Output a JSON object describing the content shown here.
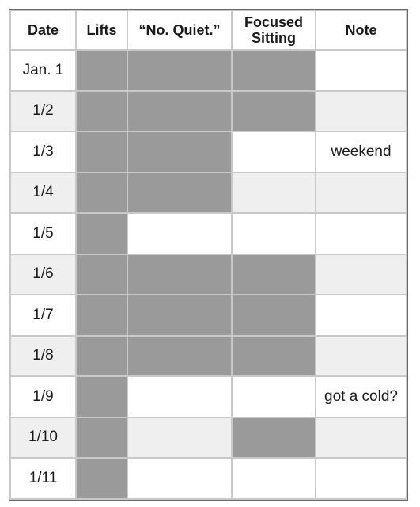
{
  "table": {
    "headers": [
      "Date",
      "Lifts",
      "“No. Quiet.”",
      "Focused Sitting",
      "Note"
    ],
    "rows": [
      {
        "date": "Jan. 1",
        "lifts": true,
        "no_quiet": true,
        "focused_sitting": true,
        "note": ""
      },
      {
        "date": "1/2",
        "lifts": true,
        "no_quiet": true,
        "focused_sitting": true,
        "note": ""
      },
      {
        "date": "1/3",
        "lifts": true,
        "no_quiet": true,
        "focused_sitting": false,
        "note": "weekend"
      },
      {
        "date": "1/4",
        "lifts": true,
        "no_quiet": true,
        "focused_sitting": false,
        "note": ""
      },
      {
        "date": "1/5",
        "lifts": true,
        "no_quiet": false,
        "focused_sitting": false,
        "note": ""
      },
      {
        "date": "1/6",
        "lifts": true,
        "no_quiet": true,
        "focused_sitting": true,
        "note": ""
      },
      {
        "date": "1/7",
        "lifts": true,
        "no_quiet": true,
        "focused_sitting": true,
        "note": ""
      },
      {
        "date": "1/8",
        "lifts": true,
        "no_quiet": true,
        "focused_sitting": true,
        "note": ""
      },
      {
        "date": "1/9",
        "lifts": true,
        "no_quiet": false,
        "focused_sitting": false,
        "note": "got a cold?"
      },
      {
        "date": "1/10",
        "lifts": true,
        "no_quiet": false,
        "focused_sitting": true,
        "note": ""
      },
      {
        "date": "1/11",
        "lifts": true,
        "no_quiet": false,
        "focused_sitting": false,
        "note": ""
      }
    ]
  },
  "colors": {
    "filled": "#9a9a9a",
    "alt_row": "#efefef",
    "border": "#c8c8c8"
  }
}
